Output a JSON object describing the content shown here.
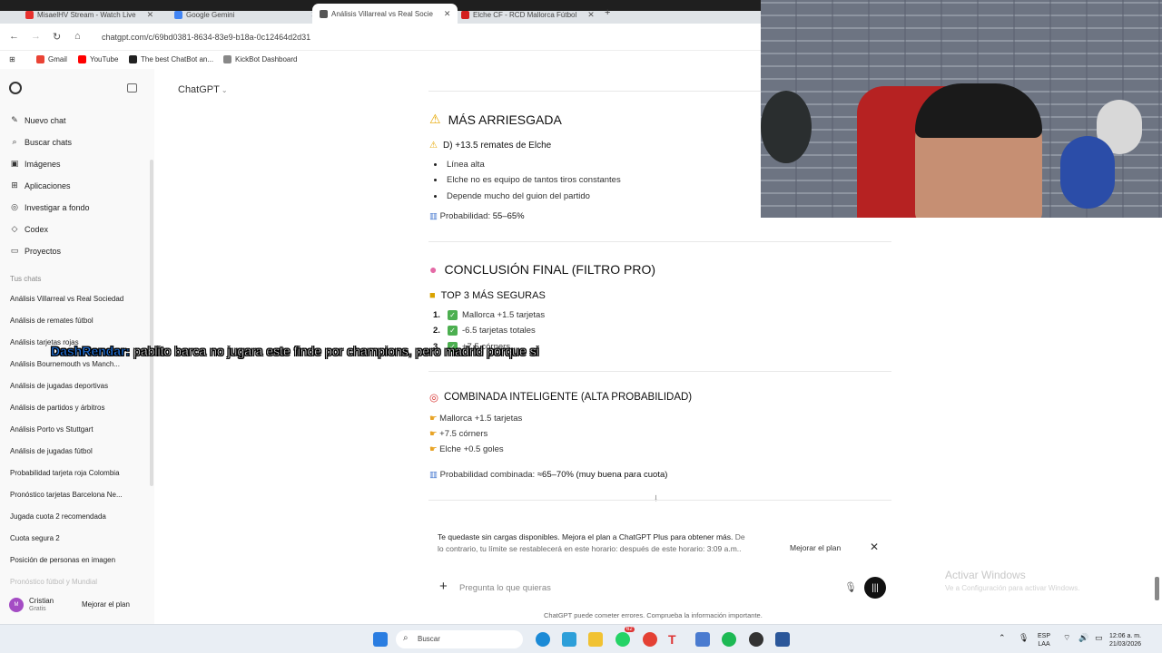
{
  "browser": {
    "tabs": [
      {
        "label": "MisaelHV Stream - Watch Live",
        "color": "#e7312e"
      },
      {
        "label": "Google Gemini",
        "color": "#4285f4"
      },
      {
        "label": "Análisis Villarreal vs Real Socie",
        "color": "#555555"
      },
      {
        "label": "Elche CF - RCD Mallorca Fútbol",
        "color": "#d4201f"
      }
    ],
    "url": "chatgpt.com/c/69bd0381-8634-83e9-b18a-0c12464d2d31",
    "bookmarks": [
      {
        "label": "Gmail",
        "color": "#ea4335"
      },
      {
        "label": "YouTube",
        "color": "#ff0000"
      },
      {
        "label": "The best ChatBot an...",
        "color": "#222222"
      },
      {
        "label": "KickBot Dashboard",
        "color": "#888888"
      }
    ]
  },
  "sidebar": {
    "nav": [
      {
        "label": "Nuevo chat",
        "icon": "✎"
      },
      {
        "label": "Buscar chats",
        "icon": "⌕"
      },
      {
        "label": "Imágenes",
        "icon": "▣"
      },
      {
        "label": "Aplicaciones",
        "icon": "⊞"
      },
      {
        "label": "Investigar a fondo",
        "icon": "◎"
      },
      {
        "label": "Codex",
        "icon": "◇"
      },
      {
        "label": "Proyectos",
        "icon": "▭"
      }
    ],
    "section": "Tus chats",
    "chats": [
      "Análisis Villarreal vs Real Sociedad",
      "Análisis de remates fútbol",
      "Análisis tarjetas rojas",
      "Análisis Bournemouth vs Manch...",
      "Análisis de jugadas deportivas",
      "Análisis de partidos y árbitros",
      "Análisis Porto vs Stuttgart",
      "Análisis de jugadas fútbol",
      "Probabilidad tarjeta roja Colombia",
      "Pronóstico tarjetas Barcelona Ne...",
      "Jugada cuota 2 recomendada",
      "Cuota segura 2",
      "Posición de personas en imagen",
      "Pronóstico fútbol y Mundial"
    ],
    "profile": {
      "initials": "M",
      "name": "Cristian",
      "plan": "Gratis",
      "upgrade": "Mejorar el plan"
    }
  },
  "main": {
    "title": "ChatGPT",
    "risky": {
      "heading": "MÁS ARRIESGADA",
      "pick": "D) +13.5 remates de Elche",
      "bullets": [
        "Línea alta",
        "Elche no es equipo de tantos tiros constantes",
        "Depende mucho del guion del partido"
      ],
      "prob_label": "Probabilidad:",
      "prob_value": "55–65%"
    },
    "conclusion": {
      "heading": "CONCLUSIÓN FINAL (FILTRO PRO)",
      "sub": "TOP 3 MÁS SEGURAS",
      "items": [
        "Mallorca +1.5 tarjetas",
        "-6.5 tarjetas totales",
        "+7.5 córners"
      ]
    },
    "combo": {
      "heading": "COMBINADA INTELIGENTE (ALTA PROBABILIDAD)",
      "items": [
        "Mallorca +1.5 tarjetas",
        "+7.5 córners",
        "Elche +0.5 goles"
      ],
      "prob_label": "Probabilidad combinada:",
      "prob_value": "≈65–70% (muy buena para cuota)"
    }
  },
  "notice": {
    "bold": "Te quedaste sin cargas disponibles. Mejora el plan a ChatGPT Plus para obtener más.",
    "light": "De lo contrario, tu límite se restablecerá en este horario: después de este horario: 3:09 a.m..",
    "upgrade": "Mejorar el plan"
  },
  "composer": {
    "placeholder": "Pregunta lo que quieras"
  },
  "disclaimer": "ChatGPT puede cometer errores. Comprueba la información importante.",
  "overlay": {
    "user": "DashRendar:",
    "message": " pablito barca no jugara este finde por champions, pero madrid porque si"
  },
  "watermark": {
    "title": "Activar Windows",
    "sub": "Ve a Configuración para activar Windows."
  },
  "taskbar": {
    "search": "Buscar",
    "badge": "62",
    "lang1": "ESP",
    "lang2": "LAA",
    "time": "12:06 a. m.",
    "date": "21/03/2026"
  }
}
